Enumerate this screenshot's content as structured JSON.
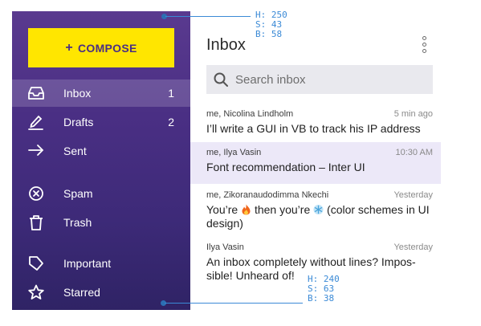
{
  "sidebar": {
    "compose_label": "COMPOSE",
    "compose_plus": "+",
    "items": [
      {
        "label": "Inbox",
        "count": "1",
        "icon": "inbox-icon"
      },
      {
        "label": "Drafts",
        "count": "2",
        "icon": "pencil-icon"
      },
      {
        "label": "Sent",
        "count": "",
        "icon": "arrow-right-icon"
      },
      {
        "label": "Spam",
        "count": "",
        "icon": "spam-icon"
      },
      {
        "label": "Trash",
        "count": "",
        "icon": "trash-icon"
      },
      {
        "label": "Important",
        "count": "",
        "icon": "label-icon"
      },
      {
        "label": "Starred",
        "count": "",
        "icon": "star-icon"
      }
    ]
  },
  "main": {
    "title": "Inbox",
    "search_placeholder": "Search inbox",
    "messages": [
      {
        "from": "me, Nicolina Lindholm",
        "time": "5 min ago",
        "subject": "I’ll write a GUI in VB to track his IP address"
      },
      {
        "from": "me, Ilya Vasin",
        "time": "10:30 AM",
        "subject": "Font recommendation – Inter UI"
      },
      {
        "from": "me, Zikoranaudodimma Nkechi",
        "time": "Yesterday",
        "subject_a": "You’re",
        "subject_b": "then you’re",
        "subject_c": "(color schemes in UI design)"
      },
      {
        "from": "Ilya Vasin",
        "time": "Yesterday",
        "subject_line1": "An inbox completely without lines? Impos-",
        "subject_line2": "sible! Unheard of!"
      }
    ]
  },
  "annotations": {
    "top": {
      "h": "H: 250",
      "s": "S: 43",
      "b": "B: 58"
    },
    "bottom": {
      "h": "H: 240",
      "s": "S: 63",
      "b": "B: 38"
    }
  },
  "colors": {
    "sidebar_top": "#5a3a8f",
    "sidebar_bottom": "#2f2365",
    "compose_bg": "#ffe600",
    "selected_row": "#ece8f8",
    "annotation": "#3b8ad6"
  }
}
